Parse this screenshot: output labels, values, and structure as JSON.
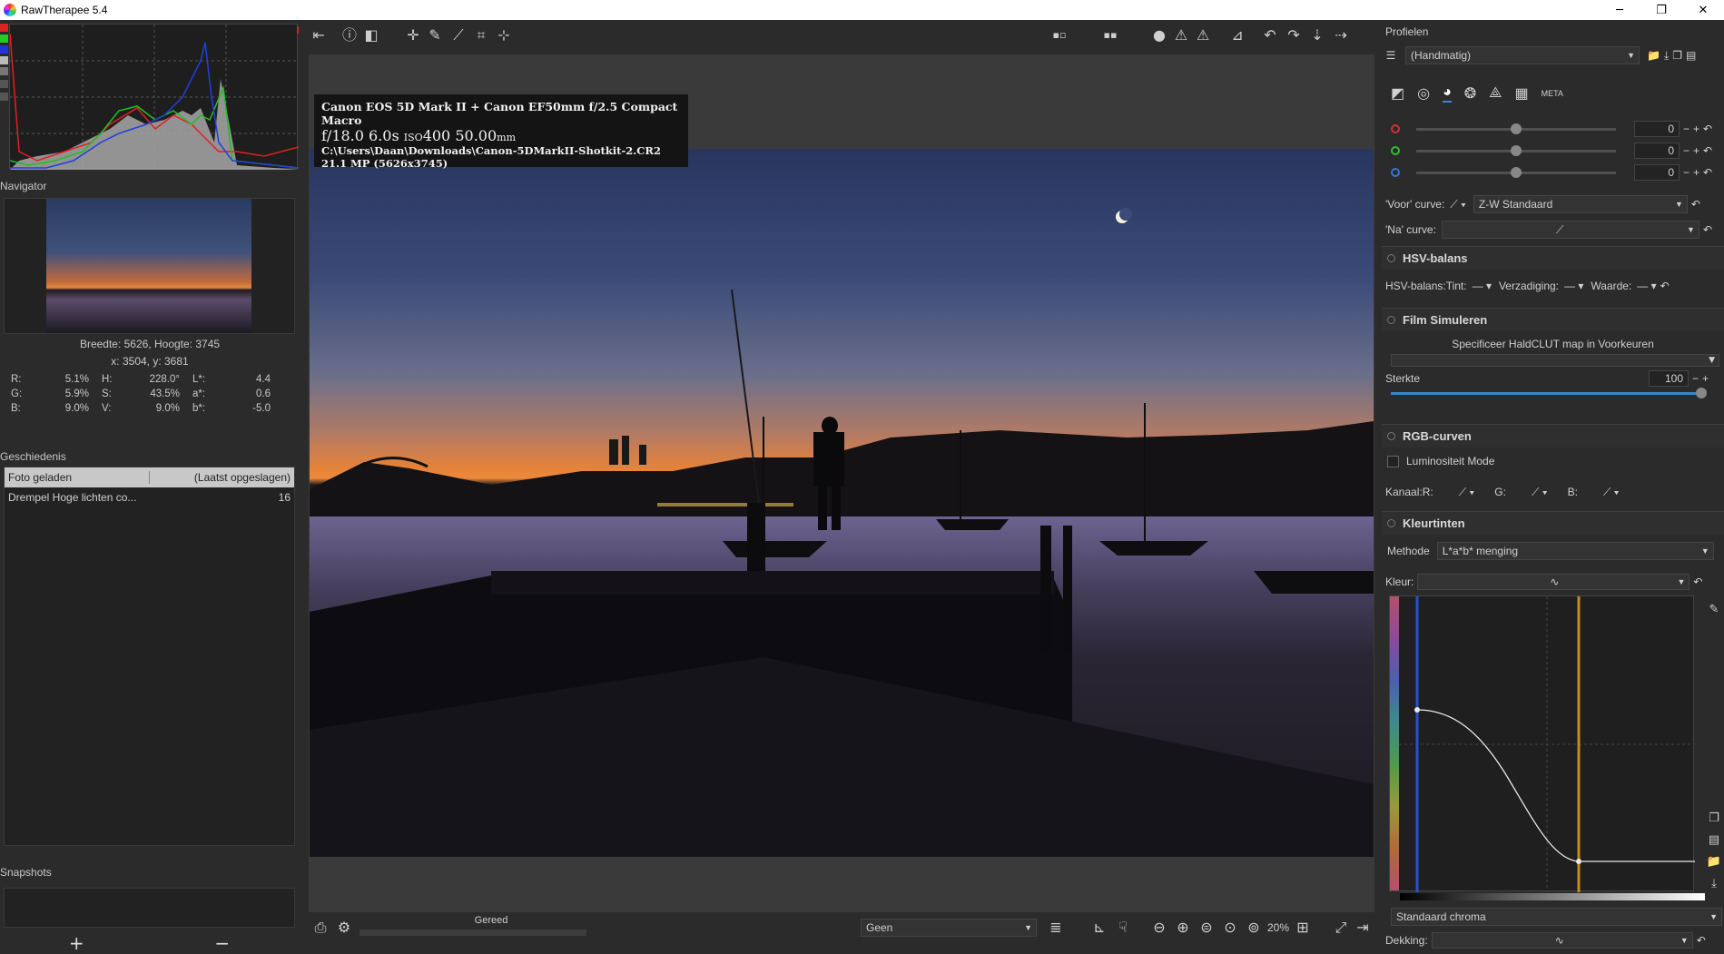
{
  "titlebar": {
    "title": "RawTherapee 5.4",
    "minimize": "─",
    "maximize": "❐",
    "close": "✕"
  },
  "left": {
    "navigator_title": "Navigator",
    "size_info": "Breedte: 5626, Hoogte: 3745",
    "coord_info": "x: 3504, y: 3681",
    "values": {
      "R_label": "R:",
      "R": "5.1%",
      "H_label": "H:",
      "H": "228.0°",
      "L_label": "L*:",
      "L": "4.4",
      "G_label": "G:",
      "G": "5.9%",
      "S_label": "S:",
      "S": "43.5%",
      "a_label": "a*:",
      "a": "0.6",
      "B_label": "B:",
      "B": "9.0%",
      "V_label": "V:",
      "V": "9.0%",
      "b_label": "b*:",
      "b": "-5.0"
    },
    "history_title": "Geschiedenis",
    "history_header": {
      "col1": "Foto geladen",
      "col2": "(Laatst opgeslagen)"
    },
    "history_rows": [
      {
        "name": "Drempel Hoge lichten co...",
        "value": "16"
      }
    ],
    "snapshots_title": "Snapshots",
    "snap_add": "+",
    "snap_remove": "−"
  },
  "center": {
    "info": {
      "camera": "Canon EOS 5D Mark II + Canon EF50mm f/2.5 Compact Macro",
      "fnumber": "f/18.0",
      "shutter": "6.0s",
      "iso_label": "ISO",
      "iso": "400",
      "focal": "50.00",
      "focal_unit": "mm",
      "path": "C:\\Users\\Daan\\Downloads\\Canon-5DMarkII-Shotkit-2.CR2",
      "megapixels": "21.1 MP (5626x3745)"
    },
    "status": "Gereed",
    "preview_select": "Geen",
    "zoom": "20%"
  },
  "right": {
    "profiles_title": "Profielen",
    "profile_value": "(Handmatig)",
    "meta_tab": "META",
    "rgb_values": [
      "0",
      "0",
      "0"
    ],
    "voor_curve_label": "'Voor' curve:",
    "voor_curve_value": "Z-W Standaard",
    "na_curve_label": "'Na'   curve:",
    "hsv_title": "HSV-balans",
    "hsv_label": "HSV-balans:",
    "tint_label": "Tint:",
    "verz_label": "Verzadiging:",
    "waarde_label": "Waarde:",
    "film_title": "Film Simuleren",
    "haldclut_text": "Specificeer HaldCLUT map in Voorkeuren",
    "sterkte_label": "Sterkte",
    "sterkte_value": "100",
    "rgb_curves_title": "RGB-curven",
    "lum_mode_label": "Luminositeit Mode",
    "kanaal_label": "Kanaal:",
    "kanaal_r": "R:",
    "kanaal_g": "G:",
    "kanaal_b": "B:",
    "kleurtinten_title": "Kleurtinten",
    "methode_label": "Methode",
    "methode_value": "L*a*b* menging",
    "kleur_label": "Kleur:",
    "chroma_value": "Standaard chroma",
    "dekking_label": "Dekking:"
  },
  "colors": {
    "accent": "#3a86c8",
    "curve_orange": "#c88a1e",
    "curve_blue": "#2a4fd0"
  }
}
